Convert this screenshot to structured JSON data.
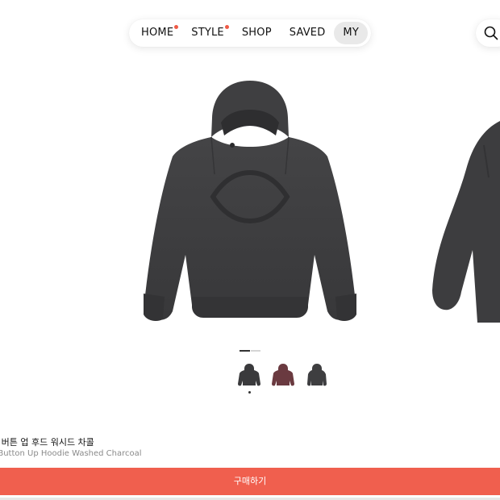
{
  "nav": {
    "items": [
      {
        "label": "HOME",
        "dot": true,
        "active": false
      },
      {
        "label": "STYLE",
        "dot": true,
        "active": false
      },
      {
        "label": "SHOP",
        "dot": false,
        "active": false
      },
      {
        "label": "SAVED",
        "dot": false,
        "active": false
      },
      {
        "label": "MY",
        "dot": false,
        "active": true
      }
    ],
    "search_icon": "search-icon"
  },
  "product": {
    "title_ko": "트 버튼 업 후드 워시드 차콜",
    "title_en": "e Button Up Hoodie Washed Charcoal",
    "carousel": {
      "current_page": 1,
      "total_pages": 2
    },
    "colors": [
      {
        "name": "charcoal",
        "hex": "#3a3a3c",
        "selected": true
      },
      {
        "name": "burgundy",
        "hex": "#6a3a40",
        "selected": false
      },
      {
        "name": "charcoal-alt",
        "hex": "#3e3e40",
        "selected": false
      }
    ]
  },
  "buy_button": {
    "label": "구매하기"
  },
  "colors": {
    "accent": "#f05f4e",
    "dot": "#ef5a46",
    "hoodie": "#3d3d3f"
  }
}
